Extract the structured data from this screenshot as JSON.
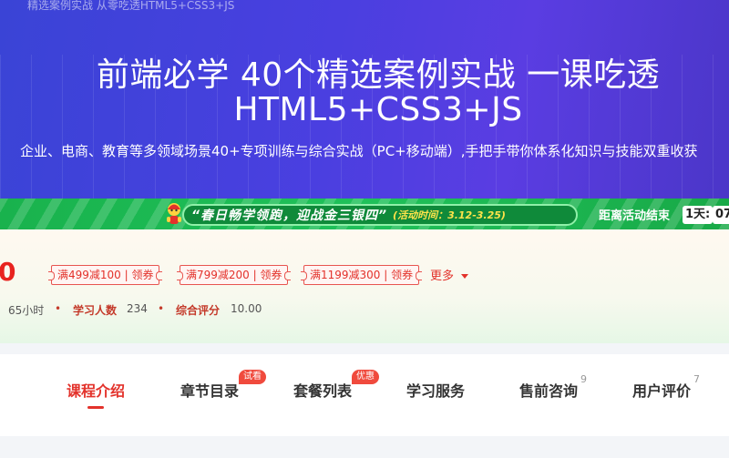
{
  "hero": {
    "caption": "精选案例实战 从零吃透HTML5+CSS3+JS",
    "title_line1": "前端必学 40个精选案例实战 一课吃透",
    "title_line2": "HTML5+CSS3+JS",
    "subtitle": "企业、电商、教育等多领域场景40+专项训练与综合实战（PC+移动端）,手把手带你体系化知识与技能双重收获"
  },
  "banner": {
    "slogan": "“春日畅学领跑，迎战金三银四”",
    "period": "(活动时间：3.12-3.25)",
    "countdown_label": "距离活动结束",
    "countdown_days": "1天:",
    "countdown_hours": "07"
  },
  "price": {
    "value": "0",
    "coupons": [
      "满499减100 | 领券",
      "满799减200 | 领券",
      "满1199减300 | 领券"
    ],
    "more_label": "更多"
  },
  "meta": {
    "duration": "65小时",
    "dot": "•",
    "learners_label": "学习人数",
    "learners_value": "234",
    "rating_label": "综合评分",
    "rating_value": "10.00"
  },
  "tabs": [
    {
      "label": "课程介绍",
      "active": true
    },
    {
      "label": "章节目录",
      "badge": "试看"
    },
    {
      "label": "套餐列表",
      "badge": "优惠"
    },
    {
      "label": "学习服务"
    },
    {
      "label": "售前咨询",
      "count": "9"
    },
    {
      "label": "用户评价",
      "count": "7"
    }
  ],
  "colors": {
    "hero_bg": "#4a3fe0",
    "banner_bg": "#1fc15a",
    "accent_red": "#e3322b",
    "period_yellow": "#ffe34a"
  },
  "icons": [
    "mascot-icon",
    "caret-down-icon"
  ]
}
